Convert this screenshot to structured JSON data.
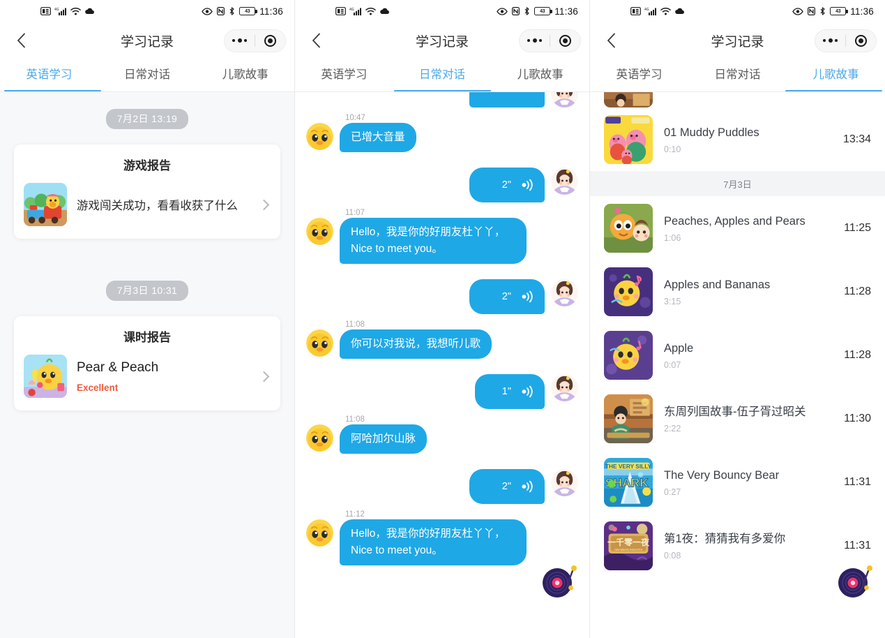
{
  "statusbar": {
    "left_icons": [
      "sim-card-icon",
      "signal-bars-icon",
      "wifi-icon",
      "cloud-icon"
    ],
    "right_icons": [
      "eye-care-icon",
      "nfc-icon",
      "bluetooth-icon"
    ],
    "battery_level": "43",
    "time": "11:36"
  },
  "navbar": {
    "title": "学习记录",
    "back_icon": "chevron-left-icon",
    "menu_icon": "more-dots-icon",
    "target_icon": "target-circle-icon"
  },
  "tabs": {
    "items": [
      {
        "label": "英语学习"
      },
      {
        "label": "日常对话"
      },
      {
        "label": "儿歌故事"
      }
    ],
    "active_indices": [
      0,
      1,
      2
    ],
    "accent": "#4aa8ea"
  },
  "panel1": {
    "groups": [
      {
        "date_chip": "7月2日 13:19",
        "card": {
          "title": "游戏报告",
          "thumb": "train-chick-thumb",
          "line1": "游戏闯关成功，看看收获了什么",
          "line2": null,
          "chevron": "chevron-right-icon"
        }
      },
      {
        "date_chip": "7月3日 10:31",
        "card": {
          "title": "课时报告",
          "thumb": "chick-fruit-thumb",
          "line1": "Pear & Peach",
          "line2": "Excellent",
          "chevron": "chevron-right-icon"
        }
      }
    ]
  },
  "panel2": {
    "bubble_color": "#1fa8e6",
    "messages": [
      {
        "side": "right",
        "type": "partial",
        "time": null,
        "text": null,
        "avatar": "girl-avatar"
      },
      {
        "side": "left",
        "type": "text",
        "time": "10:47",
        "text": "已增大音量",
        "avatar": "duck-avatar"
      },
      {
        "side": "right",
        "type": "voice",
        "time": null,
        "text": "2\"",
        "avatar": "girl-avatar"
      },
      {
        "side": "left",
        "type": "text",
        "time": "11:07",
        "text": "Hello，我是你的好朋友杜丫丫，Nice to meet you。",
        "avatar": "duck-avatar"
      },
      {
        "side": "right",
        "type": "voice",
        "time": null,
        "text": "2\"",
        "avatar": "girl-avatar"
      },
      {
        "side": "left",
        "type": "text",
        "time": "11:08",
        "text": "你可以对我说，我想听儿歌",
        "avatar": "duck-avatar"
      },
      {
        "side": "right",
        "type": "voice",
        "time": null,
        "text": "1\"",
        "avatar": "girl-avatar"
      },
      {
        "side": "left",
        "type": "text",
        "time": "11:08",
        "text": "阿哈加尔山脉",
        "avatar": "duck-avatar"
      },
      {
        "side": "right",
        "type": "voice",
        "time": null,
        "text": "2\"",
        "avatar": "girl-avatar"
      },
      {
        "side": "left",
        "type": "text",
        "time": "11:12",
        "text": "Hello，我是你的好朋友杜丫丫，Nice to meet you。",
        "avatar": "duck-avatar"
      }
    ],
    "fab": "record-player-icon"
  },
  "panel3": {
    "partial_top_thumb": "story-thumb-partial",
    "rows_before_sep": [
      {
        "thumb": "peppa-pig-thumb",
        "title": "01 Muddy Puddles",
        "duration": "0:10",
        "time": "13:34"
      }
    ],
    "day_separator": "7月3日",
    "rows_after_sep": [
      {
        "thumb": "peaches-thumb",
        "title": "Peaches, Apples and Pears",
        "duration": "1:06",
        "time": "11:25"
      },
      {
        "thumb": "bananas-thumb",
        "title": "Apples and Bananas",
        "duration": "3:15",
        "time": "11:28"
      },
      {
        "thumb": "apple-thumb",
        "title": "Apple",
        "duration": "0:07",
        "time": "11:28"
      },
      {
        "thumb": "dongzhou-thumb",
        "title": "东周列国故事-伍子胥过昭关",
        "duration": "2:22",
        "time": "11:30"
      },
      {
        "thumb": "shark-thumb",
        "title": "The Very Bouncy Bear",
        "duration": "0:27",
        "time": "11:31"
      },
      {
        "thumb": "arabian-thumb",
        "title": "第1夜：猜猜我有多爱你",
        "duration": "0:08",
        "time": "11:31"
      }
    ],
    "fab": "record-player-icon"
  }
}
